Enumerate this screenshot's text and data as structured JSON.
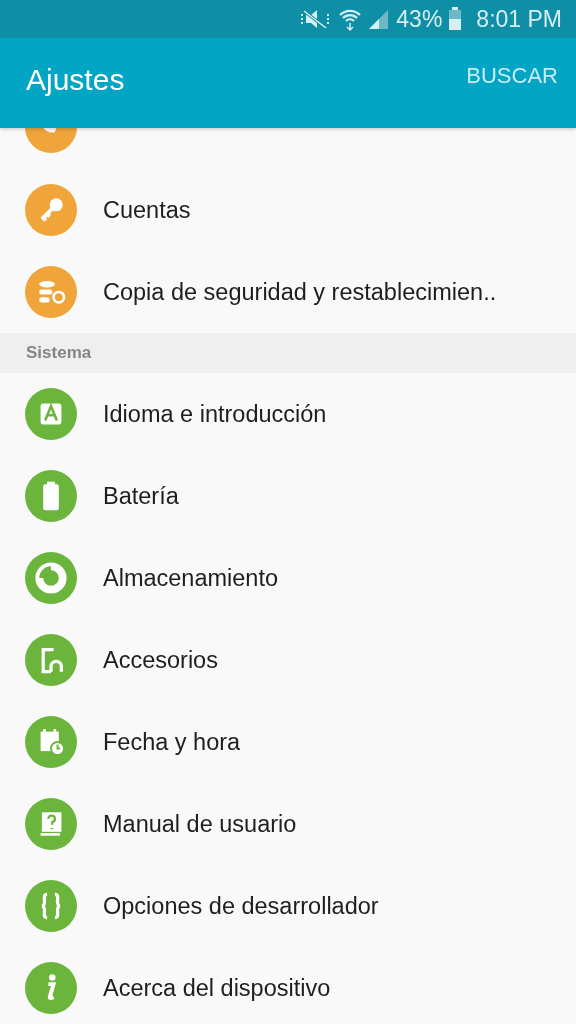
{
  "status_bar": {
    "battery": "43%",
    "time": "8:01 PM"
  },
  "app_bar": {
    "title": "Ajustes",
    "action": "BUSCAR"
  },
  "sections": [
    {
      "items": [
        {
          "color": "#f0a53b"
        },
        {
          "label": "Cuentas",
          "color": "#f0a53b"
        },
        {
          "label": "Copia de seguridad y restablecimien..",
          "color": "#f0a53b"
        }
      ]
    },
    {
      "header": "Sistema",
      "items": [
        {
          "label": "Idioma e introducción",
          "color": "#6cb53d"
        },
        {
          "label": "Batería",
          "color": "#6cb53d"
        },
        {
          "label": "Almacenamiento",
          "color": "#6cb53d"
        },
        {
          "label": "Accesorios",
          "color": "#6cb53d"
        },
        {
          "label": "Fecha y hora",
          "color": "#6cb53d"
        },
        {
          "label": "Manual de usuario",
          "color": "#6cb53d"
        },
        {
          "label": "Opciones de desarrollador",
          "color": "#6cb53d"
        },
        {
          "label": "Acerca del dispositivo",
          "color": "#6cb53d"
        }
      ]
    }
  ]
}
